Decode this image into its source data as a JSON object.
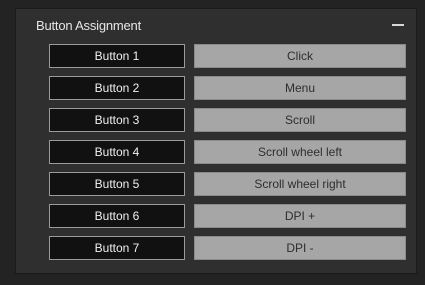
{
  "panel": {
    "title": "Button Assignment",
    "collapse_icon": "minus-icon"
  },
  "assignments": [
    {
      "button": "Button 1",
      "action": "Click"
    },
    {
      "button": "Button 2",
      "action": "Menu"
    },
    {
      "button": "Button 3",
      "action": "Scroll"
    },
    {
      "button": "Button 4",
      "action": "Scroll wheel left"
    },
    {
      "button": "Button 5",
      "action": "Scroll wheel right"
    },
    {
      "button": "Button 6",
      "action": "DPI +"
    },
    {
      "button": "Button 7",
      "action": "DPI -"
    }
  ],
  "colors": {
    "background": "#232323",
    "panel": "#2f2f2f",
    "label_bg": "#111111",
    "assign_bg": "#a6a6a6"
  }
}
